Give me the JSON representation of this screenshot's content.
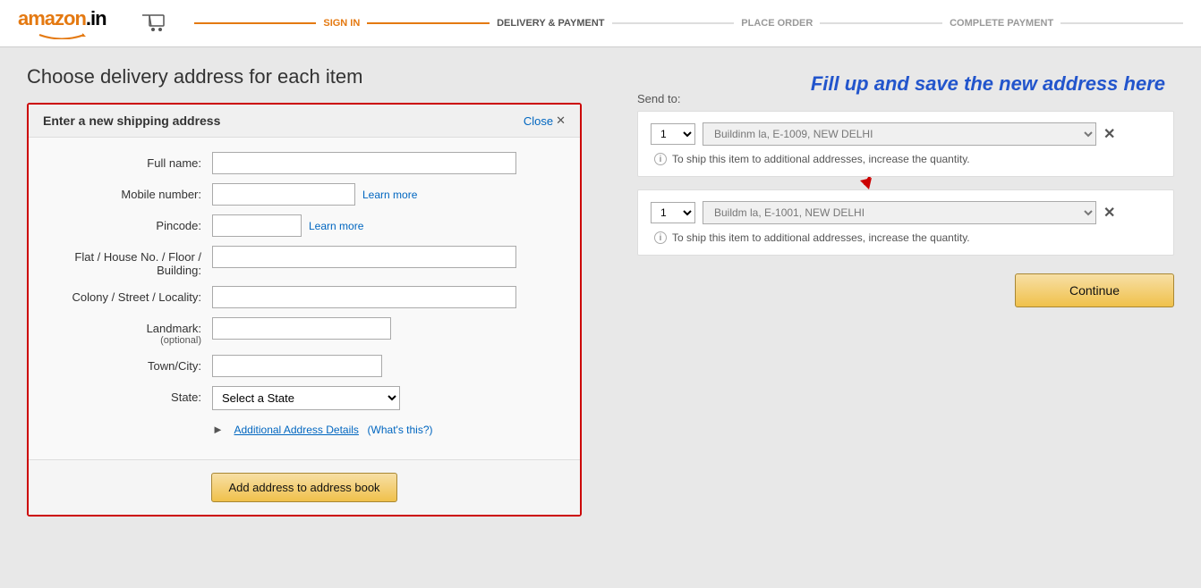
{
  "header": {
    "logo": "amazon.in",
    "cart_icon": "🛒",
    "steps": [
      {
        "label": "SIGN IN",
        "state": "done"
      },
      {
        "label": "DELIVERY & PAYMENT",
        "state": "active"
      },
      {
        "label": "PLACE ORDER",
        "state": "inactive"
      },
      {
        "label": "COMPLETE PAYMENT",
        "state": "inactive"
      }
    ]
  },
  "page": {
    "title": "Choose delivery address for each item"
  },
  "annotation": {
    "text": "Fill up and save the new address here"
  },
  "form": {
    "title": "Enter a new shipping address",
    "close_label": "Close",
    "fields": {
      "full_name_label": "Full name:",
      "mobile_label": "Mobile number:",
      "mobile_learn_more": "Learn more",
      "pincode_label": "Pincode:",
      "pincode_learn_more": "Learn more",
      "flat_label": "Flat / House No. / Floor / Building:",
      "colony_label": "Colony / Street / Locality:",
      "landmark_label": "Landmark:",
      "landmark_optional": "(optional)",
      "town_label": "Town/City:",
      "state_label": "State:",
      "state_placeholder": "Select a State",
      "additional_label": "Additional Address Details",
      "whats_this": "(What's this?)"
    },
    "submit_label": "Add address to address book"
  },
  "right_panel": {
    "send_to": "Send to:",
    "item1": {
      "address": "Buildinm la, E-1009, NEW DELHI",
      "ship_info": "To ship this item to additional addresses, increase the quantity."
    },
    "item2": {
      "address": "Buildm la, E-1001, NEW DELHI",
      "ship_info": "To ship this item to additional addresses, increase the quantity."
    },
    "continue_label": "Continue"
  }
}
